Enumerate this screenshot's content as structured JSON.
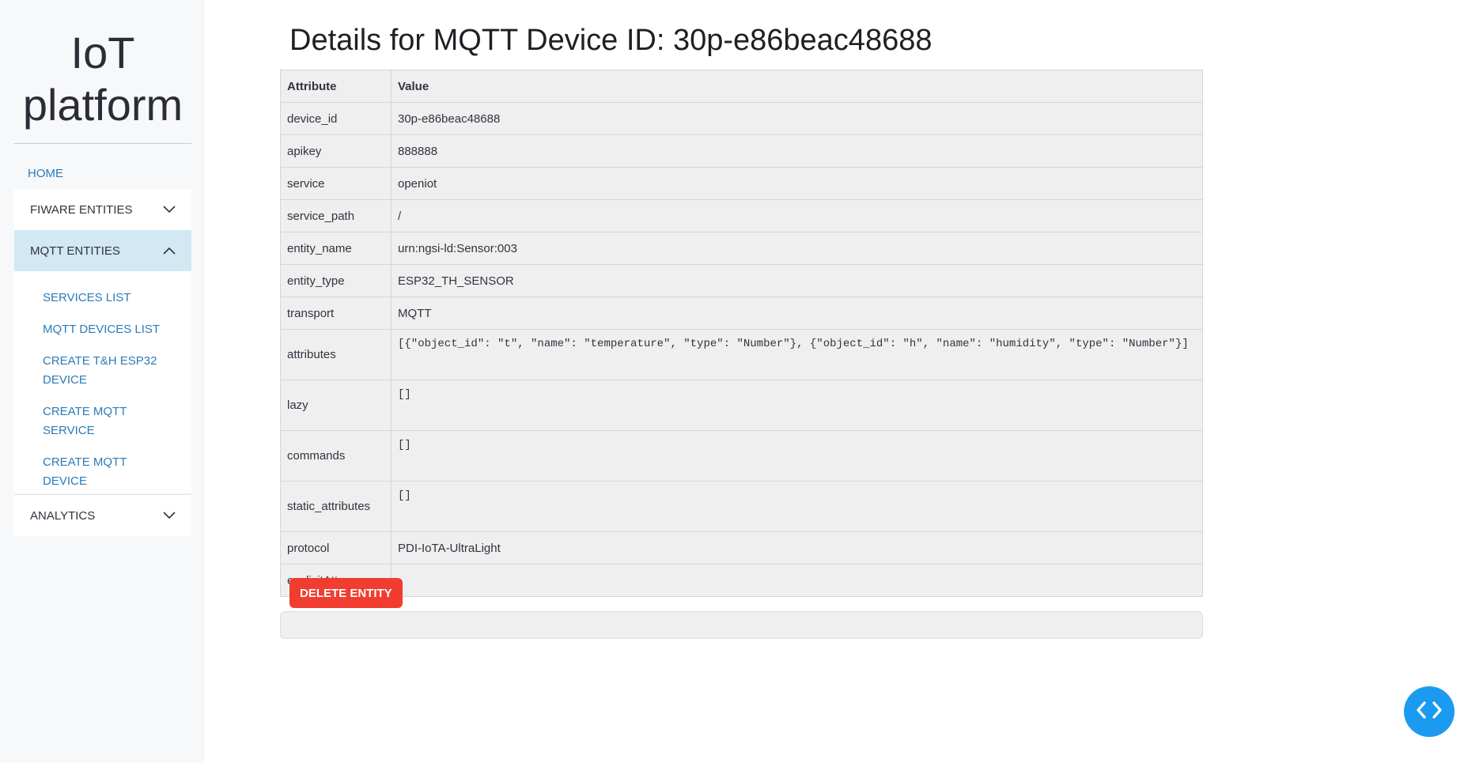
{
  "sidebar": {
    "brand_line1": "IoT",
    "brand_line2": "platform",
    "home_label": "HOME",
    "sections": [
      {
        "label": "FIWARE ENTITIES",
        "expanded": false
      },
      {
        "label": "MQTT ENTITIES",
        "expanded": true,
        "items": [
          "SERVICES LIST",
          "MQTT DEVICES LIST",
          "CREATE T&H ESP32 DEVICE",
          "CREATE MQTT SERVICE",
          "CREATE MQTT DEVICE"
        ]
      },
      {
        "label": "ANALYTICS",
        "expanded": false
      }
    ]
  },
  "main": {
    "title": "Details for MQTT Device ID: 30p-e86beac48688",
    "table": {
      "headers": [
        "Attribute",
        "Value"
      ],
      "rows": [
        {
          "attribute": "device_id",
          "value": "30p-e86beac48688"
        },
        {
          "attribute": "apikey",
          "value": "888888"
        },
        {
          "attribute": "service",
          "value": "openiot"
        },
        {
          "attribute": "service_path",
          "value": "/"
        },
        {
          "attribute": "entity_name",
          "value": "urn:ngsi-ld:Sensor:003"
        },
        {
          "attribute": "entity_type",
          "value": "ESP32_TH_SENSOR"
        },
        {
          "attribute": "transport",
          "value": "MQTT"
        },
        {
          "attribute": "attributes",
          "value": "[{\"object_id\": \"t\", \"name\": \"temperature\", \"type\": \"Number\"}, {\"object_id\": \"h\", \"name\": \"humidity\", \"type\": \"Number\"}]"
        },
        {
          "attribute": "lazy",
          "value": "[]"
        },
        {
          "attribute": "commands",
          "value": "[]"
        },
        {
          "attribute": "static_attributes",
          "value": "[]"
        },
        {
          "attribute": "protocol",
          "value": "PDI-IoTA-UltraLight"
        },
        {
          "attribute": "explicitAttrs",
          "value": ""
        }
      ]
    },
    "delete_label": "DELETE ENTITY"
  },
  "colors": {
    "accent": "#2b7bb9",
    "danger": "#f13c30",
    "fab": "#1b9bf0",
    "sidebar_bg": "#f7f8fa",
    "active_section_bg": "#d2e8f2",
    "table_bg": "#efefef"
  },
  "icons": {
    "collapsed": "chevron-down-icon",
    "expanded": "chevron-up-icon",
    "fab": "code-icon"
  }
}
